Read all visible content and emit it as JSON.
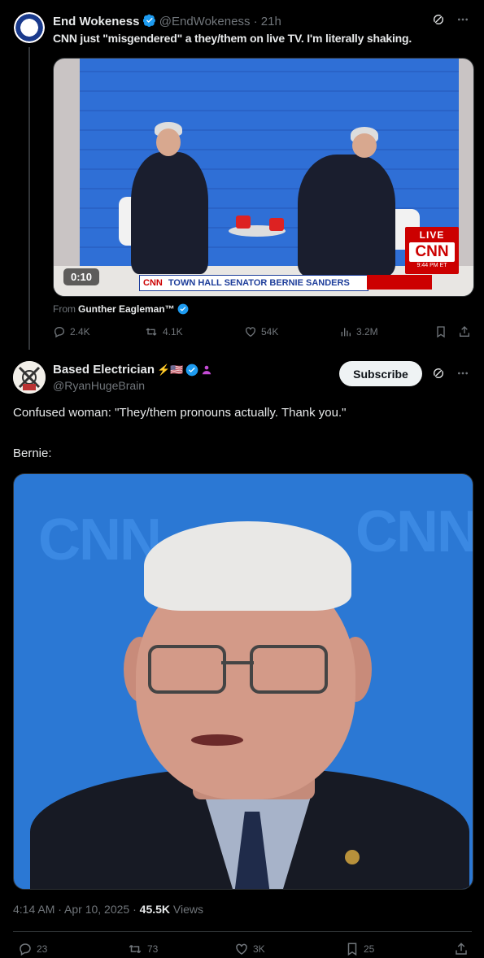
{
  "quoted": {
    "name": "End Wokeness",
    "handle": "@EndWokeness",
    "time": "· 21h",
    "text": "CNN just \"misgendered\" a they/them on live TV. I'm literally shaking.",
    "video": {
      "duration": "0:10",
      "chyron_cnn": "CNN",
      "chyron_townhall": "TOWN HALL",
      "chyron_subject": "SENATOR BERNIE SANDERS",
      "live_label": "LIVE",
      "live_logo": "CNN",
      "live_time": "9:44 PM ET"
    },
    "from_label": "From",
    "from_name": "Gunther Eagleman™",
    "stats": {
      "replies": "2.4K",
      "reposts": "4.1K",
      "likes": "54K",
      "views": "3.2M"
    }
  },
  "tweet": {
    "name": "Based Electrician",
    "name_emojis": "⚡🇺🇸",
    "handle": "@RyanHugeBrain",
    "subscribe_label": "Subscribe",
    "text_line1": "Confused woman: \"They/them pronouns actually. Thank you.\"",
    "text_line2": "Bernie:",
    "image_bg_text": "CNN",
    "timestamp": "4:14 AM · Apr 10, 2025 · ",
    "views_count": "45.5K",
    "views_label": " Views",
    "stats": {
      "replies": "23",
      "reposts": "73",
      "likes": "3K",
      "bookmarks": "25"
    }
  },
  "colors": {
    "background": "#000000",
    "text": "#e7e9ea",
    "muted": "#71767b",
    "verified": "#1d9bf0",
    "cnn_red": "#cc0000"
  },
  "icons": [
    "verified-badge",
    "grok-icon",
    "more-icon",
    "reply-icon",
    "repost-icon",
    "like-icon",
    "views-icon",
    "bookmark-icon",
    "share-icon"
  ]
}
